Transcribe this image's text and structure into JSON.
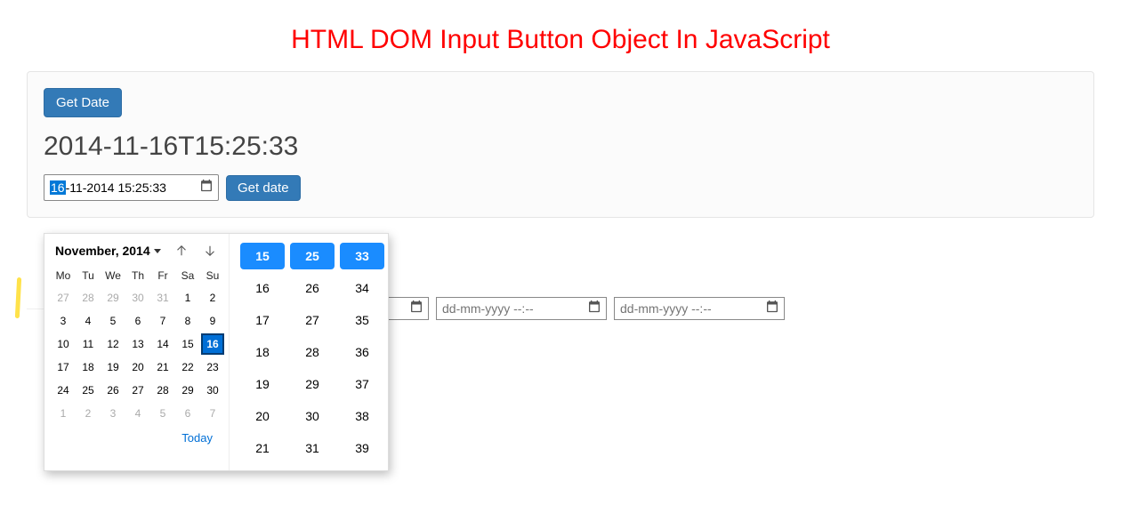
{
  "page": {
    "title": "HTML DOM Input Button Object In JavaScript"
  },
  "panel": {
    "get_date_btn": "Get Date",
    "datetime_text": "2014-11-16T15:25:33",
    "input_prefix_selected": "16",
    "input_rest": "-11-2014 15:25:33",
    "get_date_btn2": "Get date"
  },
  "extra_inputs": {
    "placeholder": "dd-mm-yyyy --:--"
  },
  "calendar": {
    "month_label": "November, 2014",
    "dow": [
      "Mo",
      "Tu",
      "We",
      "Th",
      "Fr",
      "Sa",
      "Su"
    ],
    "weeks": [
      [
        {
          "n": 27,
          "m": 1
        },
        {
          "n": 28,
          "m": 1
        },
        {
          "n": 29,
          "m": 1
        },
        {
          "n": 30,
          "m": 1
        },
        {
          "n": 31,
          "m": 1
        },
        {
          "n": 1
        },
        {
          "n": 2
        }
      ],
      [
        {
          "n": 3
        },
        {
          "n": 4
        },
        {
          "n": 5
        },
        {
          "n": 6
        },
        {
          "n": 7
        },
        {
          "n": 8
        },
        {
          "n": 9
        }
      ],
      [
        {
          "n": 10
        },
        {
          "n": 11
        },
        {
          "n": 12
        },
        {
          "n": 13
        },
        {
          "n": 14
        },
        {
          "n": 15
        },
        {
          "n": 16,
          "s": 1
        }
      ],
      [
        {
          "n": 17
        },
        {
          "n": 18
        },
        {
          "n": 19
        },
        {
          "n": 20
        },
        {
          "n": 21
        },
        {
          "n": 22
        },
        {
          "n": 23
        }
      ],
      [
        {
          "n": 24
        },
        {
          "n": 25
        },
        {
          "n": 26
        },
        {
          "n": 27
        },
        {
          "n": 28
        },
        {
          "n": 29
        },
        {
          "n": 30
        }
      ],
      [
        {
          "n": 1,
          "m": 1
        },
        {
          "n": 2,
          "m": 1
        },
        {
          "n": 3,
          "m": 1
        },
        {
          "n": 4,
          "m": 1
        },
        {
          "n": 5,
          "m": 1
        },
        {
          "n": 6,
          "m": 1
        },
        {
          "n": 7,
          "m": 1
        }
      ]
    ],
    "today_label": "Today"
  },
  "time_picker": {
    "rows": [
      [
        {
          "v": 15,
          "s": 1
        },
        {
          "v": 25,
          "s": 1
        },
        {
          "v": 33,
          "s": 1
        }
      ],
      [
        {
          "v": 16
        },
        {
          "v": 26
        },
        {
          "v": 34
        }
      ],
      [
        {
          "v": 17
        },
        {
          "v": 27
        },
        {
          "v": 35
        }
      ],
      [
        {
          "v": 18
        },
        {
          "v": 28
        },
        {
          "v": 36
        }
      ],
      [
        {
          "v": 19
        },
        {
          "v": 29
        },
        {
          "v": 37
        }
      ],
      [
        {
          "v": 20
        },
        {
          "v": 30
        },
        {
          "v": 38
        }
      ],
      [
        {
          "v": 21
        },
        {
          "v": 31
        },
        {
          "v": 39
        }
      ]
    ]
  }
}
